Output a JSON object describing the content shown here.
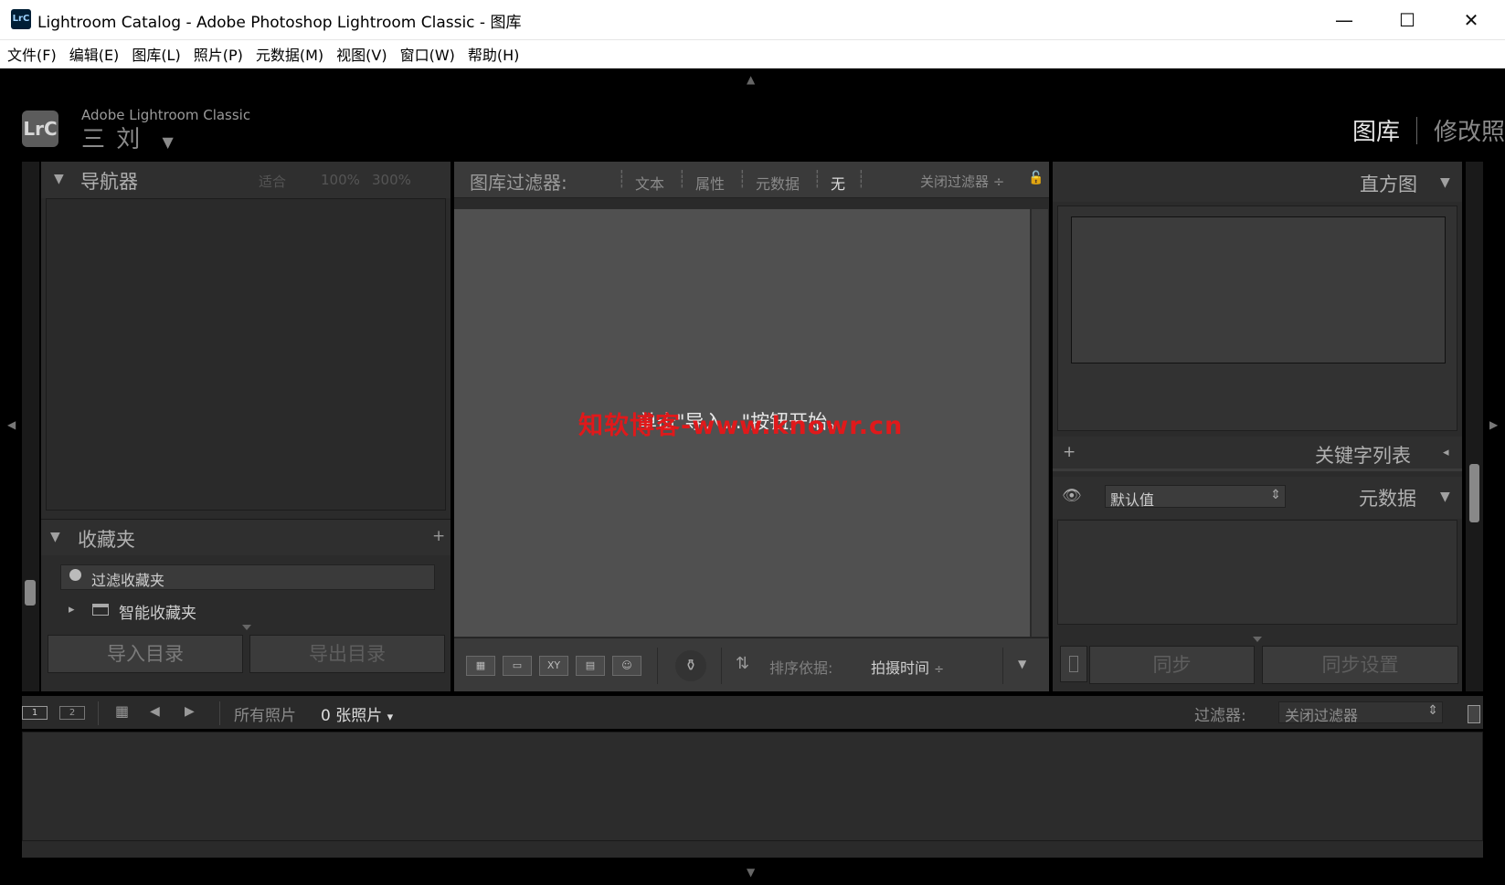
{
  "window": {
    "app_icon_label": "LrC",
    "title": "Lightroom Catalog - Adobe Photoshop Lightroom Classic - 图库",
    "minimize_glyph": "—",
    "maximize_glyph": "☐",
    "close_glyph": "✕"
  },
  "menubar": {
    "items": [
      "文件(F)",
      "编辑(E)",
      "图库(L)",
      "照片(P)",
      "元数据(M)",
      "视图(V)",
      "窗口(W)",
      "帮助(H)"
    ]
  },
  "identity": {
    "badge": "LrC",
    "brand": "Adobe Lightroom Classic",
    "catalog_name": "三 刘",
    "dropdown_glyph": "▼"
  },
  "modules": {
    "active": "图库",
    "next": "修改照"
  },
  "navigator": {
    "collapse_glyph": "▼",
    "title": "导航器",
    "zoom_fit": "适合",
    "zoom_100": "100%",
    "zoom_300": "300%"
  },
  "collections": {
    "collapse_glyph": "▼",
    "title": "收藏夹",
    "add_glyph": "+",
    "filter_placeholder": "过滤收藏夹",
    "smart_expand_glyph": "▸",
    "smart_label": "智能收藏夹"
  },
  "left_buttons": {
    "import": "导入目录",
    "export": "导出目录"
  },
  "library_filter": {
    "label": "图库过滤器:",
    "text": "文本",
    "attribute": "属性",
    "metadata": "元数据",
    "none": "无",
    "close_filter": "关闭过滤器",
    "close_filter_arrow": "÷",
    "lock_glyph": "🔓"
  },
  "grid": {
    "empty_message": "单击\"导入...\"按钮开始。"
  },
  "toolbar": {
    "grid_view": "▦",
    "loupe_view": "▭",
    "compare_view": "XY",
    "survey_view": "▤",
    "people_view": "☺",
    "spray_glyph": "⚱",
    "sort_icon": "⇅",
    "sort_label": "排序依据:",
    "sort_value": "拍摄时间",
    "sort_arrow": "÷",
    "menu_glyph": "▼"
  },
  "right_panel": {
    "histogram_title": "直方图",
    "histogram_glyph": "▼",
    "keyword_add": "+",
    "keyword_title": "关键字列表",
    "keyword_glyph": "◂",
    "metadata_eye": "👁",
    "metadata_preset": "默认值",
    "metadata_preset_arrow": "⇕",
    "metadata_title": "元数据",
    "metadata_glyph": "▼",
    "sync": "同步",
    "sync_settings": "同步设置"
  },
  "filmstrip_bar": {
    "monitor_1": "1",
    "monitor_2": "2",
    "grid_glyph": "▦",
    "back_glyph": "◀",
    "forward_glyph": "▶",
    "source": "所有照片",
    "count": "0 张照片",
    "count_arrow": "▾",
    "filter_label": "过滤器:",
    "filter_value": "关闭过滤器",
    "filter_arrow": "⇕"
  },
  "watermark": "知软博客-www.knowr.cn",
  "edges": {
    "top_arrow": "▲",
    "bottom_arrow": "▼",
    "left_arrow": "◀",
    "right_arrow": "▶"
  }
}
